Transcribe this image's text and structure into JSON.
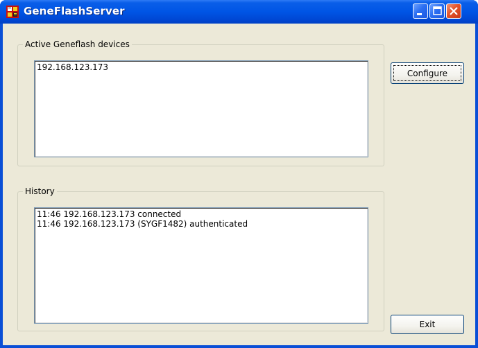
{
  "window": {
    "title": "GeneFlashServer"
  },
  "active_group": {
    "legend": "Active Geneflash devices",
    "items": [
      "192.168.123.173"
    ]
  },
  "history_group": {
    "legend": "History",
    "items": [
      "11:46 192.168.123.173 connected",
      "11:46 192.168.123.173 (SYGF1482) authenticated"
    ]
  },
  "buttons": {
    "configure_label": "Configure",
    "exit_label": "Exit"
  },
  "colors": {
    "titlebar": "#0055e5",
    "client_background": "#ece9d8",
    "close_button": "#e3532a"
  }
}
